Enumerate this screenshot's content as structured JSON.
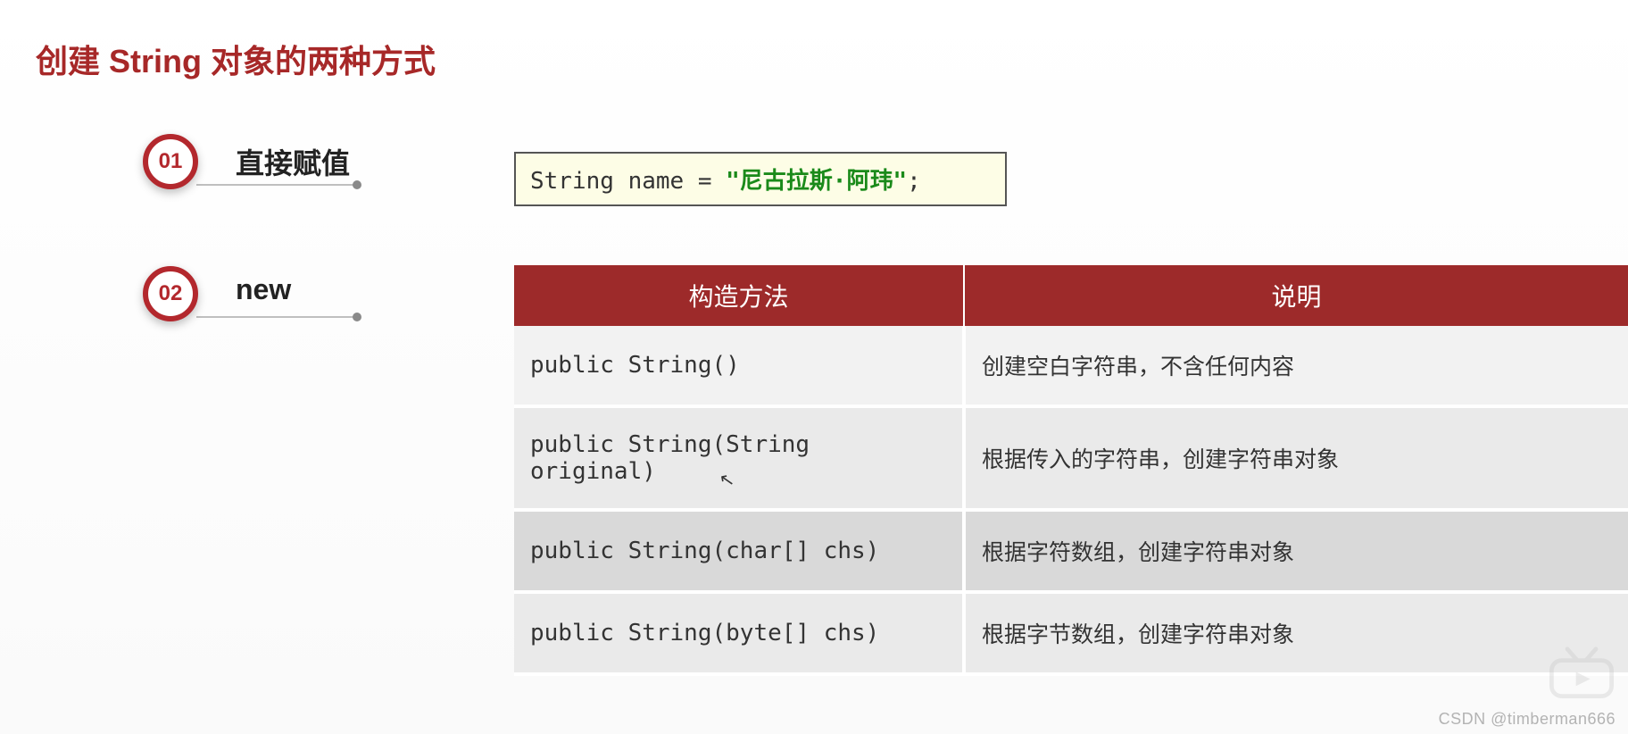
{
  "title": "创建 String 对象的两种方式",
  "badge1": {
    "num": "01",
    "label": "直接赋值"
  },
  "badge2": {
    "num": "02",
    "label": "new"
  },
  "code": {
    "prefix": "String name = ",
    "string": "\"尼古拉斯·阿玮\"",
    "suffix": ";"
  },
  "table": {
    "header": {
      "col1": "构造方法",
      "col2": "说明"
    },
    "rows": [
      {
        "sig": "public String()",
        "desc": "创建空白字符串，不含任何内容"
      },
      {
        "sig": "public String(String original)",
        "desc": "根据传入的字符串，创建字符串对象"
      },
      {
        "sig": "public String(char[] chs)",
        "desc": "根据字符数组，创建字符串对象"
      },
      {
        "sig": "public String(byte[] chs)",
        "desc": "根据字节数组，创建字符串对象"
      }
    ]
  },
  "watermark": "CSDN @timberman666"
}
